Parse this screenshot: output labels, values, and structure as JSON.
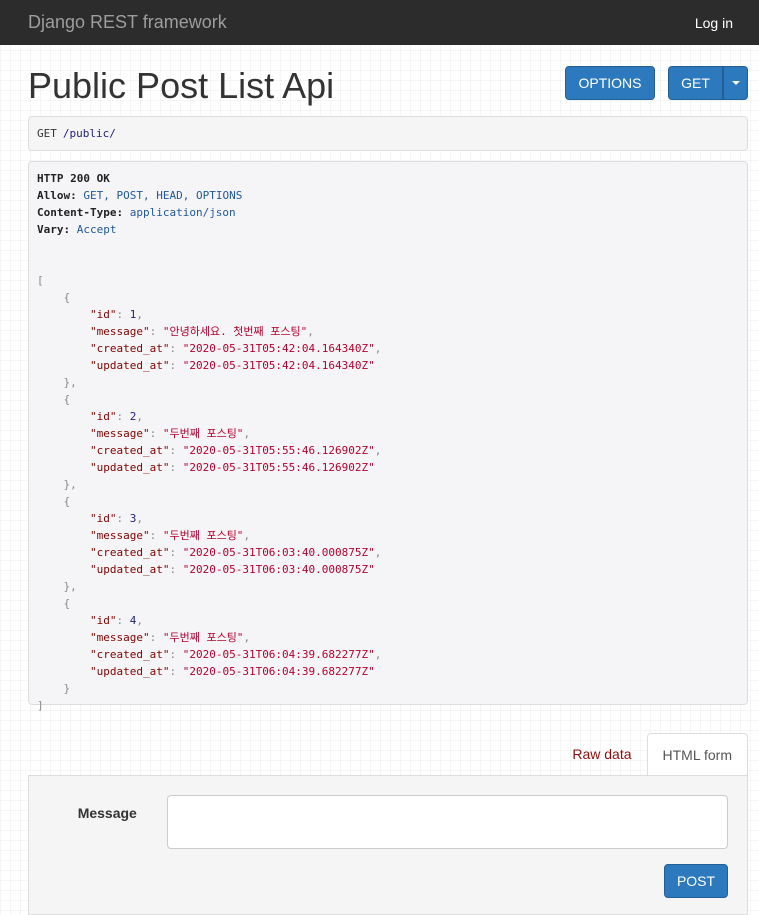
{
  "navbar": {
    "brand": "Django REST framework",
    "login": "Log in"
  },
  "page": {
    "title": "Public Post List Api",
    "options_label": "OPTIONS",
    "get_label": "GET"
  },
  "request": {
    "method": "GET",
    "path": "/public/"
  },
  "response": {
    "status": "HTTP 200 OK",
    "headers": [
      {
        "name": "Allow:",
        "value": "GET, POST, HEAD, OPTIONS"
      },
      {
        "name": "Content-Type:",
        "value": "application/json"
      },
      {
        "name": "Vary:",
        "value": "Accept"
      }
    ],
    "items": [
      {
        "id": "1",
        "message": "\"안녕하세요. 첫번째 포스팅\"",
        "created_at": "\"2020-05-31T05:42:04.164340Z\"",
        "updated_at": "\"2020-05-31T05:42:04.164340Z\""
      },
      {
        "id": "2",
        "message": "\"두번째 포스팅\"",
        "created_at": "\"2020-05-31T05:55:46.126902Z\"",
        "updated_at": "\"2020-05-31T05:55:46.126902Z\""
      },
      {
        "id": "3",
        "message": "\"두번째 포스팅\"",
        "created_at": "\"2020-05-31T06:03:40.000875Z\"",
        "updated_at": "\"2020-05-31T06:03:40.000875Z\""
      },
      {
        "id": "4",
        "message": "\"두번째 포스팅\"",
        "created_at": "\"2020-05-31T06:04:39.682277Z\"",
        "updated_at": "\"2020-05-31T06:04:39.682277Z\""
      }
    ],
    "keys": {
      "id": "\"id\"",
      "message": "\"message\"",
      "created_at": "\"created_at\"",
      "updated_at": "\"updated_at\""
    }
  },
  "tabs": {
    "raw": "Raw data",
    "html": "HTML form"
  },
  "form": {
    "message_label": "Message",
    "message_value": "",
    "post_label": "POST"
  },
  "colors": {
    "navbar": "#2c2c2c",
    "button": "#2c79bd",
    "string": "#b5002e",
    "key": "#800000"
  }
}
